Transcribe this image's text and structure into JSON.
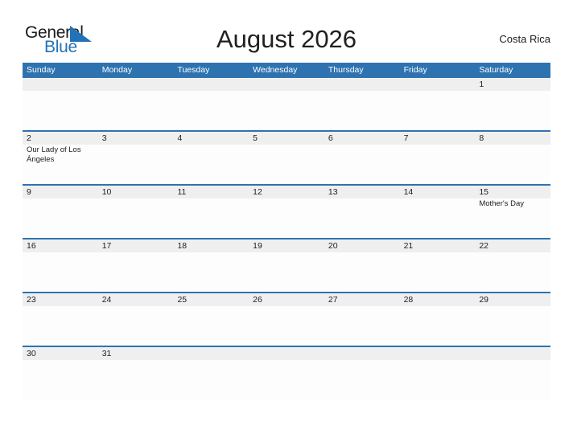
{
  "brand": {
    "name_part1": "General",
    "name_part2": "Blue",
    "color_dark": "#1b1b1b",
    "color_blue": "#2272b8"
  },
  "header": {
    "title": "August 2026",
    "locality": "Costa Rica"
  },
  "theme": {
    "header_blue": "#2e73b0",
    "band_gray": "#efefef",
    "cell_white": "#fdfdfd",
    "text_dark": "#1d1d1d"
  },
  "calendar": {
    "month": "August",
    "year": "2026",
    "day_headers": [
      "Sunday",
      "Monday",
      "Tuesday",
      "Wednesday",
      "Thursday",
      "Friday",
      "Saturday"
    ],
    "weeks": [
      {
        "days": [
          {
            "num": "",
            "events": []
          },
          {
            "num": "",
            "events": []
          },
          {
            "num": "",
            "events": []
          },
          {
            "num": "",
            "events": []
          },
          {
            "num": "",
            "events": []
          },
          {
            "num": "",
            "events": []
          },
          {
            "num": "1",
            "events": []
          }
        ]
      },
      {
        "days": [
          {
            "num": "2",
            "events": [
              "Our Lady of Los Ángeles"
            ]
          },
          {
            "num": "3",
            "events": []
          },
          {
            "num": "4",
            "events": []
          },
          {
            "num": "5",
            "events": []
          },
          {
            "num": "6",
            "events": []
          },
          {
            "num": "7",
            "events": []
          },
          {
            "num": "8",
            "events": []
          }
        ]
      },
      {
        "days": [
          {
            "num": "9",
            "events": []
          },
          {
            "num": "10",
            "events": []
          },
          {
            "num": "11",
            "events": []
          },
          {
            "num": "12",
            "events": []
          },
          {
            "num": "13",
            "events": []
          },
          {
            "num": "14",
            "events": []
          },
          {
            "num": "15",
            "events": [
              "Mother's Day"
            ]
          }
        ]
      },
      {
        "days": [
          {
            "num": "16",
            "events": []
          },
          {
            "num": "17",
            "events": []
          },
          {
            "num": "18",
            "events": []
          },
          {
            "num": "19",
            "events": []
          },
          {
            "num": "20",
            "events": []
          },
          {
            "num": "21",
            "events": []
          },
          {
            "num": "22",
            "events": []
          }
        ]
      },
      {
        "days": [
          {
            "num": "23",
            "events": []
          },
          {
            "num": "24",
            "events": []
          },
          {
            "num": "25",
            "events": []
          },
          {
            "num": "26",
            "events": []
          },
          {
            "num": "27",
            "events": []
          },
          {
            "num": "28",
            "events": []
          },
          {
            "num": "29",
            "events": []
          }
        ]
      },
      {
        "days": [
          {
            "num": "30",
            "events": []
          },
          {
            "num": "31",
            "events": []
          },
          {
            "num": "",
            "events": []
          },
          {
            "num": "",
            "events": []
          },
          {
            "num": "",
            "events": []
          },
          {
            "num": "",
            "events": []
          },
          {
            "num": "",
            "events": []
          }
        ]
      }
    ]
  }
}
